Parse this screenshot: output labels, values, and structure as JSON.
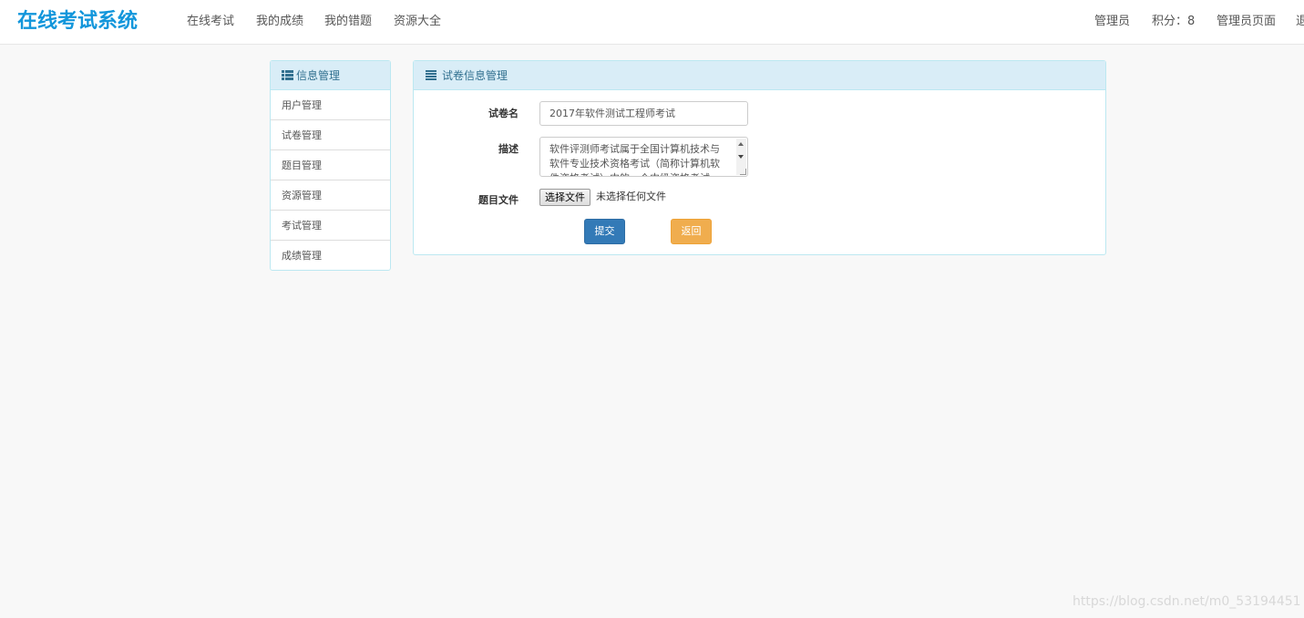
{
  "navbar": {
    "brand": "在线考试系统",
    "links": [
      "在线考试",
      "我的成绩",
      "我的错题",
      "资源大全"
    ],
    "right": {
      "user": "管理员",
      "points": "积分：8",
      "admin_page": "管理员页面",
      "logout_partial": "退"
    }
  },
  "sidebar": {
    "title": "信息管理",
    "items": [
      {
        "label": "用户管理"
      },
      {
        "label": "试卷管理"
      },
      {
        "label": "题目管理"
      },
      {
        "label": "资源管理"
      },
      {
        "label": "考试管理"
      },
      {
        "label": "成绩管理"
      }
    ]
  },
  "main": {
    "title": "试卷信息管理",
    "form": {
      "name_label": "试卷名",
      "name_value": "2017年软件测试工程师考试",
      "desc_label": "描述",
      "desc_value": "软件评测师考试属于全国计算机技术与软件专业技术资格考试（简称计算机软件资格考试）中的一个中级资格考试。",
      "file_label": "题目文件",
      "file_button": "选择文件",
      "file_status": "未选择任何文件",
      "submit_label": "提交",
      "back_label": "返回"
    }
  },
  "watermark": "https://blog.csdn.net/m0_53194451",
  "colors": {
    "brand": "#1296db",
    "panel_head_bg": "#d9edf7",
    "panel_head_text": "#31708f",
    "submit_btn": "#337ab7",
    "back_btn": "#f0ad4e"
  }
}
